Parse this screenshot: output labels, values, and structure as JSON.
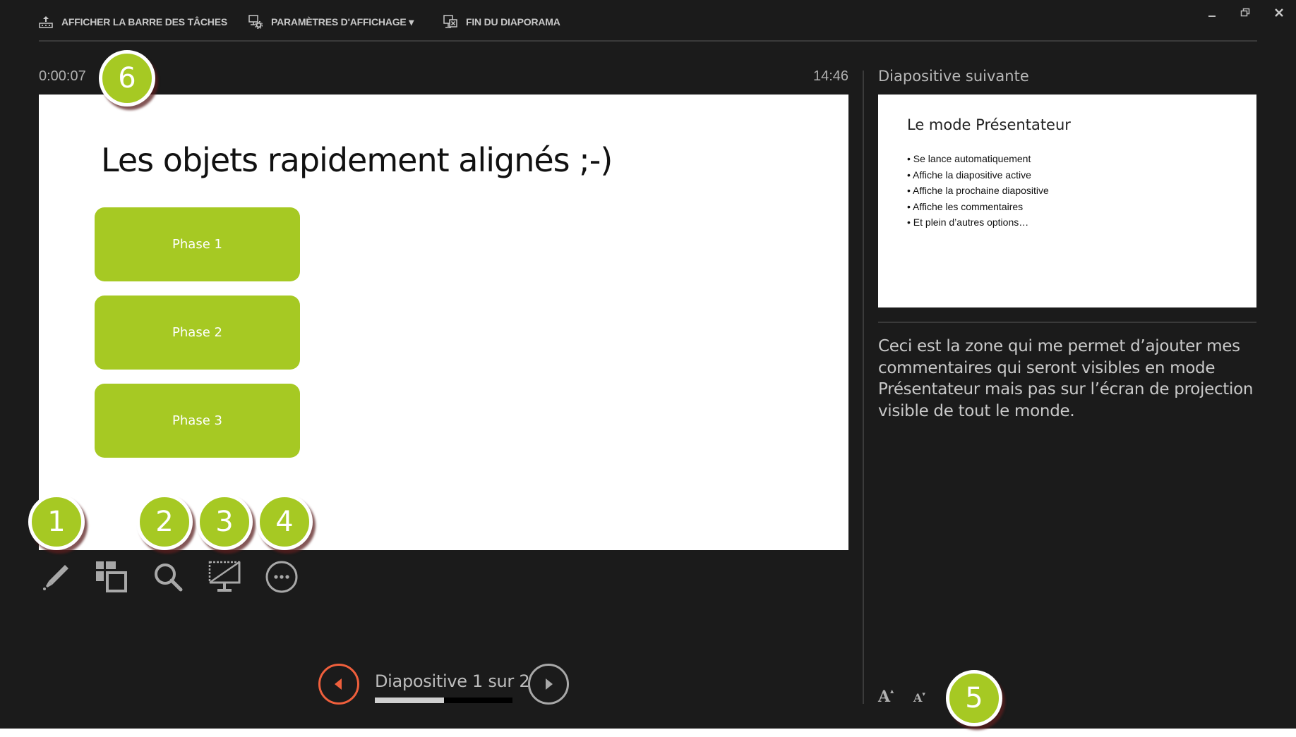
{
  "topbar": {
    "show_taskbar_label": "AFFICHER LA BARRE DES TÂCHES",
    "display_settings_label": "PARAMÈTRES D'AFFICHAGE ▾",
    "end_show_label": "FIN DU DIAPORAMA"
  },
  "window_controls": {
    "minimize": "–",
    "restore": "❐",
    "close": "✕"
  },
  "timer": "0:00:07",
  "clock": "14:46",
  "current_slide": {
    "title": "Les objets rapidement alignés ;-)",
    "shapes": [
      "Phase 1",
      "Phase 2",
      "Phase 3"
    ]
  },
  "next_slide": {
    "label": "Diapositive suivante",
    "title": "Le mode Présentateur",
    "bullets": [
      "Se lance automatiquement",
      "Affiche la diapositive active",
      "Affiche la prochaine diapositive",
      "Affiche les commentaires",
      "Et plein d’autres options…"
    ]
  },
  "notes": "Ceci est la zone qui me permet d’ajouter mes commentaires qui seront visibles en mode Présentateur mais pas sur l’écran de projection visible de tout le monde.",
  "tools": [
    "pen-tool",
    "see-all-slides",
    "zoom-into-slide",
    "black-screen",
    "more-options"
  ],
  "navigation": {
    "counter": "Diapositive 1 sur 2",
    "progress_fraction": 0.5
  },
  "font_controls": {
    "increase": "A",
    "decrease": "A"
  },
  "callouts": [
    "1",
    "2",
    "3",
    "4",
    "5",
    "6"
  ],
  "colors": {
    "accent_green": "#a6c923",
    "prev_orange": "#ef5f3c",
    "background": "#1b1b1b"
  }
}
